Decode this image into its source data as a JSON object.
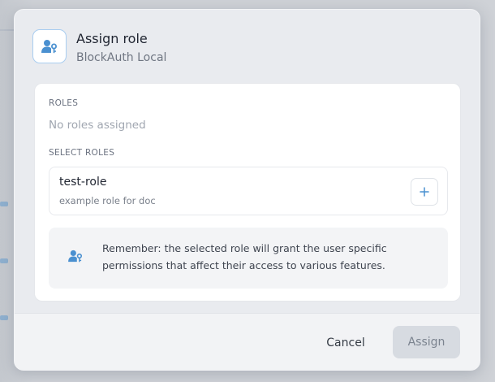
{
  "dialog": {
    "title": "Assign role",
    "subtitle": "BlockAuth Local",
    "icon": "user-key-icon"
  },
  "roles_section": {
    "label": "ROLES",
    "empty_text": "No roles assigned"
  },
  "select_section": {
    "label": "SELECT ROLES",
    "items": [
      {
        "name": "test-role",
        "description": "example role for doc",
        "action_icon": "plus-icon"
      }
    ]
  },
  "notice": {
    "icon": "user-key-icon",
    "text": "Remember: the selected role will grant the user specific permissions that affect their access to various features."
  },
  "footer": {
    "cancel_label": "Cancel",
    "assign_label": "Assign"
  },
  "colors": {
    "accent": "#4a90d0",
    "disabled_button": "#d7dbe1"
  }
}
